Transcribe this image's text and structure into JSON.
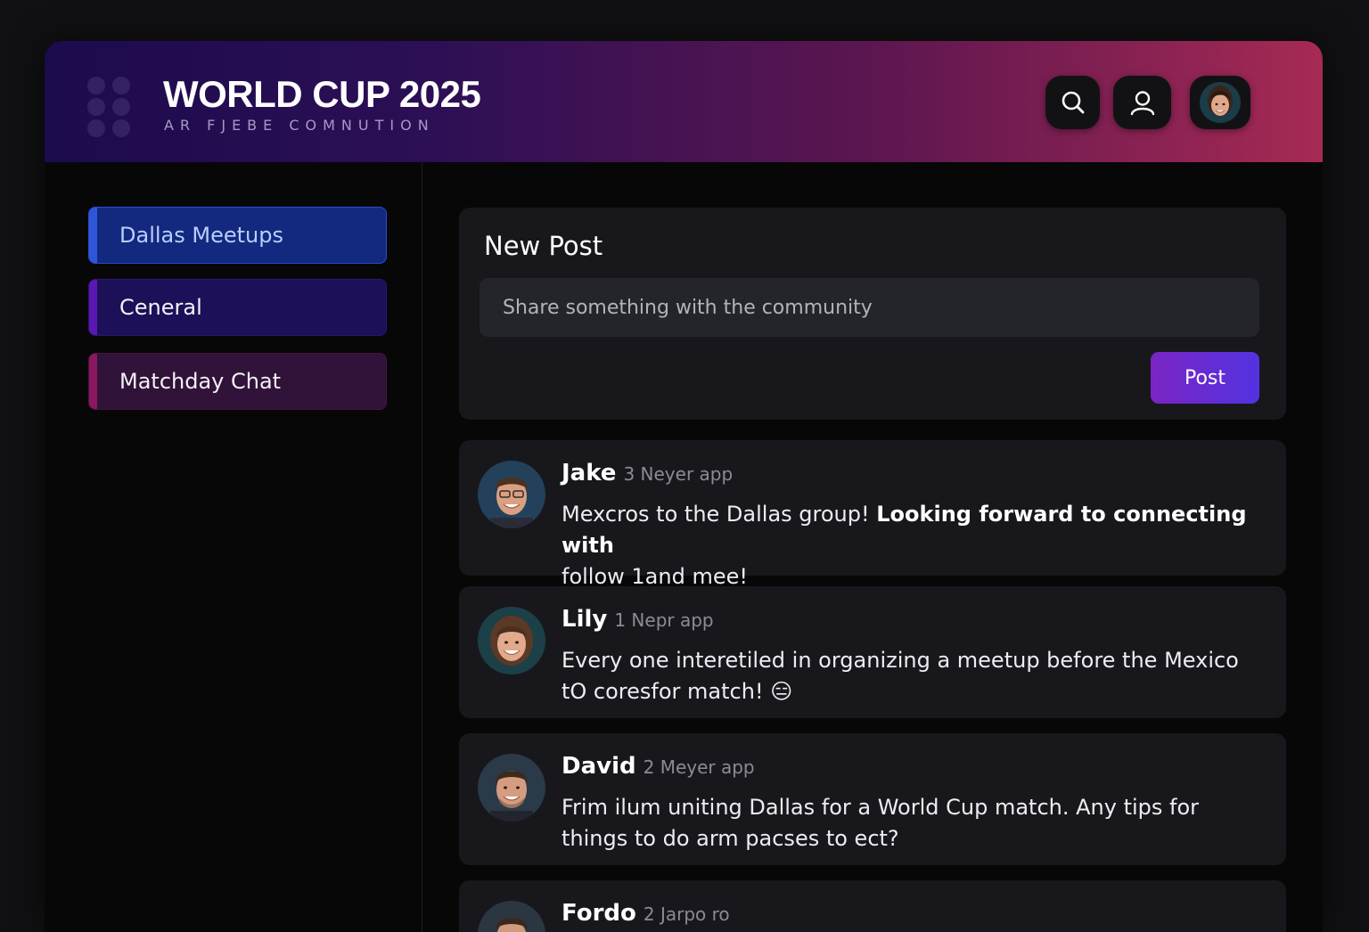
{
  "header": {
    "title": "WORLD CUP 2025",
    "subtitle": "AR FJEBE COMNUTION",
    "search_icon": "search-icon",
    "user_icon": "user-icon",
    "avatar_icon": "profile-avatar"
  },
  "sidebar": {
    "items": [
      {
        "label": "Dallas Meetups",
        "active": true,
        "color": "#2f56d8"
      },
      {
        "label": "Ceneral",
        "active": false,
        "color": "#5a17b2"
      },
      {
        "label": "Matchday Chat",
        "active": false,
        "color": "#8a1760"
      }
    ]
  },
  "composer": {
    "title": "New Post",
    "placeholder": "Share something with the community",
    "value": "",
    "button_label": "Post"
  },
  "posts": [
    {
      "author": "Jake",
      "time": "3 Neyer app",
      "text_plain": "Mexcros to the Dallas group! ",
      "text_bold": "Looking forward to connecting with",
      "text_rest": "follow 1and mee!"
    },
    {
      "author": "Lily",
      "time": "1 Nepr app",
      "text": "Every one interetiled in organizing a meetup before the Mexico tO coresfor match!",
      "emoji": "😑"
    },
    {
      "author": "David",
      "time": "2 Meyer app",
      "text": "Frim ilum uniting Dallas for a World Cup match. Any tips for things to do arm pacses to ect?"
    },
    {
      "author": "Fordo",
      "time": "2 Jarpo ro"
    }
  ],
  "colors": {
    "header_gradient_start": "#1c0b4d",
    "header_gradient_end": "#a62a54",
    "accent": "#5332e0",
    "card_bg": "#18181c"
  }
}
